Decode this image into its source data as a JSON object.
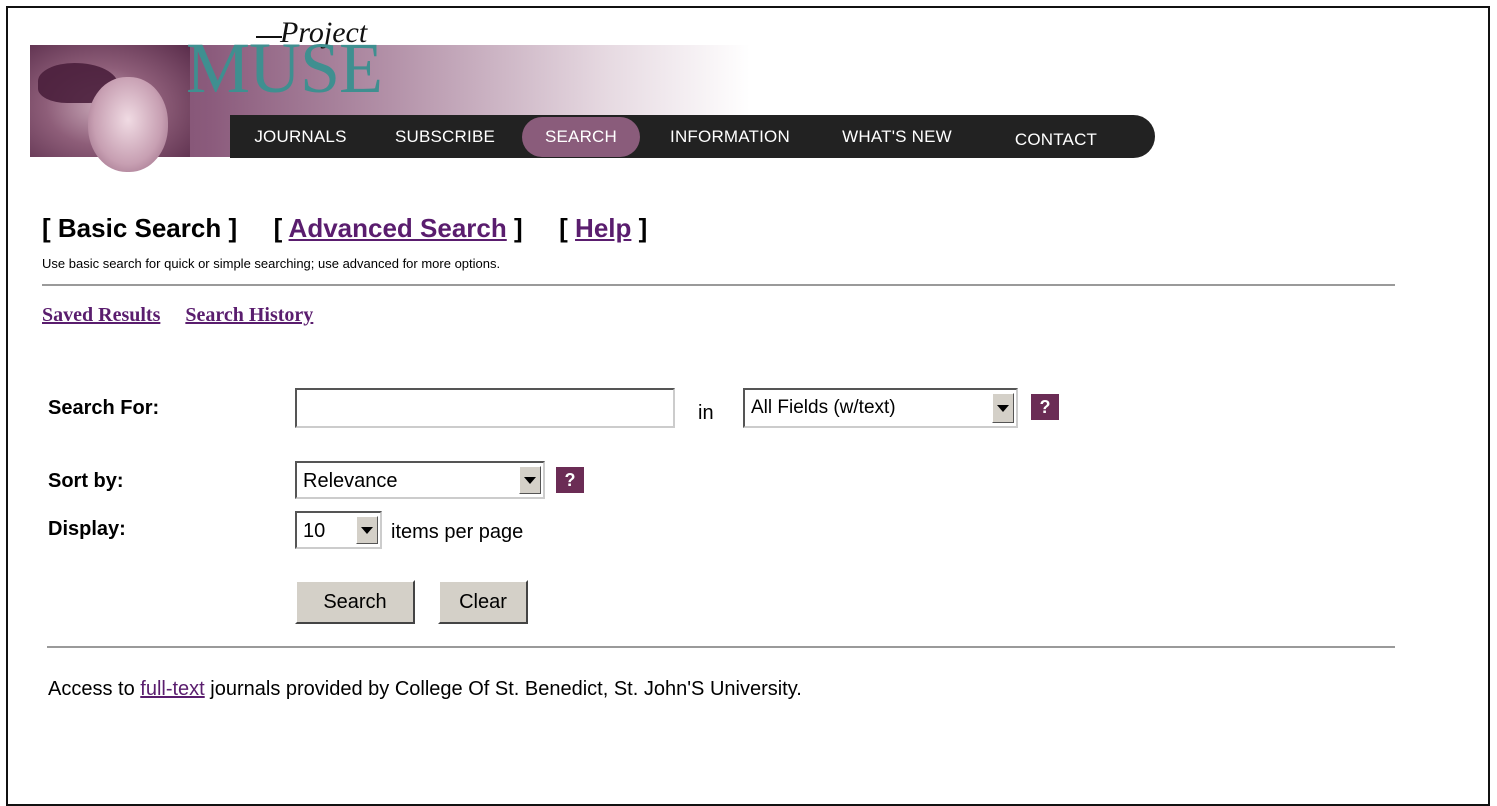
{
  "logo": {
    "line1": "Project",
    "line2": "MUSE"
  },
  "nav": [
    {
      "label": "JOURNALS"
    },
    {
      "label": "SUBSCRIBE"
    },
    {
      "label": "SEARCH"
    },
    {
      "label": "INFORMATION"
    },
    {
      "label": "WHAT'S NEW"
    },
    {
      "label": "CONTACT"
    }
  ],
  "tabs": {
    "basic": "Basic Search",
    "advanced": "Advanced Search",
    "help": "Help",
    "open_bracket": "[",
    "close_bracket": "]"
  },
  "hint": "Use basic search for quick or simple searching; use advanced for more options.",
  "links": {
    "saved": "Saved Results",
    "history": "Search History"
  },
  "form": {
    "search_label": "Search For:",
    "search_value": "",
    "in_label": "in",
    "field_select": "All Fields (w/text)",
    "sort_label": "Sort by:",
    "sort_select": "Relevance",
    "display_label": "Display:",
    "display_select": "10",
    "per_page": "items per page",
    "help_glyph": "?",
    "search_button": "Search",
    "clear_button": "Clear"
  },
  "footer": {
    "prefix": "Access to ",
    "link": "full-text",
    "suffix": " journals provided by College Of St. Benedict, St. John'S University."
  }
}
